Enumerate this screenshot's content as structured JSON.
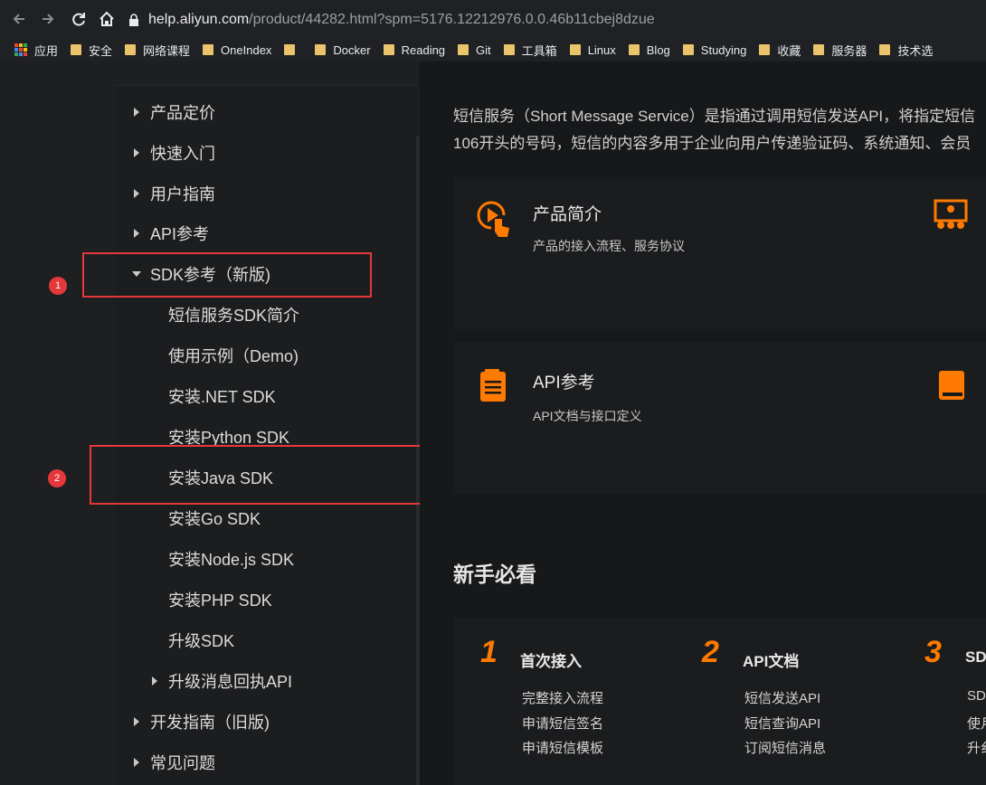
{
  "browser": {
    "url_host": "help.aliyun.com",
    "url_path": "/product/44282.html?spm=5176.12212976.0.0.46b11cbej8dzue"
  },
  "bookmarks": [
    {
      "label": "应用",
      "icon": "apps-icon"
    },
    {
      "label": "安全",
      "icon": "folder-icon"
    },
    {
      "label": "网络课程",
      "icon": "folder-icon"
    },
    {
      "label": "OneIndex",
      "icon": "folder-icon"
    },
    {
      "label": "",
      "icon": "folder-icon"
    },
    {
      "label": "Docker",
      "icon": "folder-icon"
    },
    {
      "label": "Reading",
      "icon": "folder-icon"
    },
    {
      "label": "Git",
      "icon": "folder-icon"
    },
    {
      "label": "工具箱",
      "icon": "folder-icon"
    },
    {
      "label": "Linux",
      "icon": "folder-icon"
    },
    {
      "label": "Blog",
      "icon": "folder-icon"
    },
    {
      "label": "Studying",
      "icon": "folder-icon"
    },
    {
      "label": "收藏",
      "icon": "folder-icon"
    },
    {
      "label": "服务器",
      "icon": "folder-icon"
    },
    {
      "label": "技术选",
      "icon": "folder-icon"
    }
  ],
  "sidebar": {
    "items": [
      {
        "label": "产品定价"
      },
      {
        "label": "快速入门"
      },
      {
        "label": "用户指南"
      },
      {
        "label": "API参考"
      },
      {
        "label": "SDK参考（新版)"
      },
      {
        "label": "短信服务SDK简介"
      },
      {
        "label": "使用示例（Demo)"
      },
      {
        "label": "安装.NET SDK"
      },
      {
        "label": "安装Python SDK"
      },
      {
        "label": "安装Java SDK"
      },
      {
        "label": "安装Go SDK"
      },
      {
        "label": "安装Node.js SDK"
      },
      {
        "label": "安装PHP SDK"
      },
      {
        "label": "升级SDK"
      },
      {
        "label": "升级消息回执API"
      },
      {
        "label": "开发指南（旧版)"
      },
      {
        "label": "常见问题"
      }
    ]
  },
  "annotations": {
    "marker1": "1",
    "marker2": "2",
    "color": "#e5383b"
  },
  "main": {
    "intro_line1": "短信服务（Short Message Service）是指通过调用短信发送API，将指定短信",
    "intro_line2": "106开头的号码，短信的内容多用于企业向用户传递验证码、系统通知、会员",
    "cards": [
      {
        "title": "产品简介",
        "desc": "产品的接入流程、服务协议",
        "icon": "play-touch-icon"
      },
      {
        "title": "API参考",
        "desc": "API文档与接口定义",
        "icon": "document-icon"
      }
    ],
    "section_title": "新手必看",
    "steps": [
      {
        "num": "1",
        "title": "首次接入",
        "links": [
          "完整接入流程",
          "申请短信签名",
          "申请短信模板"
        ]
      },
      {
        "num": "2",
        "title": "API文档",
        "links": [
          "短信发送API",
          "短信查询API",
          "订阅短信消息"
        ]
      },
      {
        "num": "3",
        "title": "SD",
        "links": [
          "SD",
          "使月",
          "升纟"
        ]
      }
    ],
    "accent_color": "#ff7a00"
  }
}
